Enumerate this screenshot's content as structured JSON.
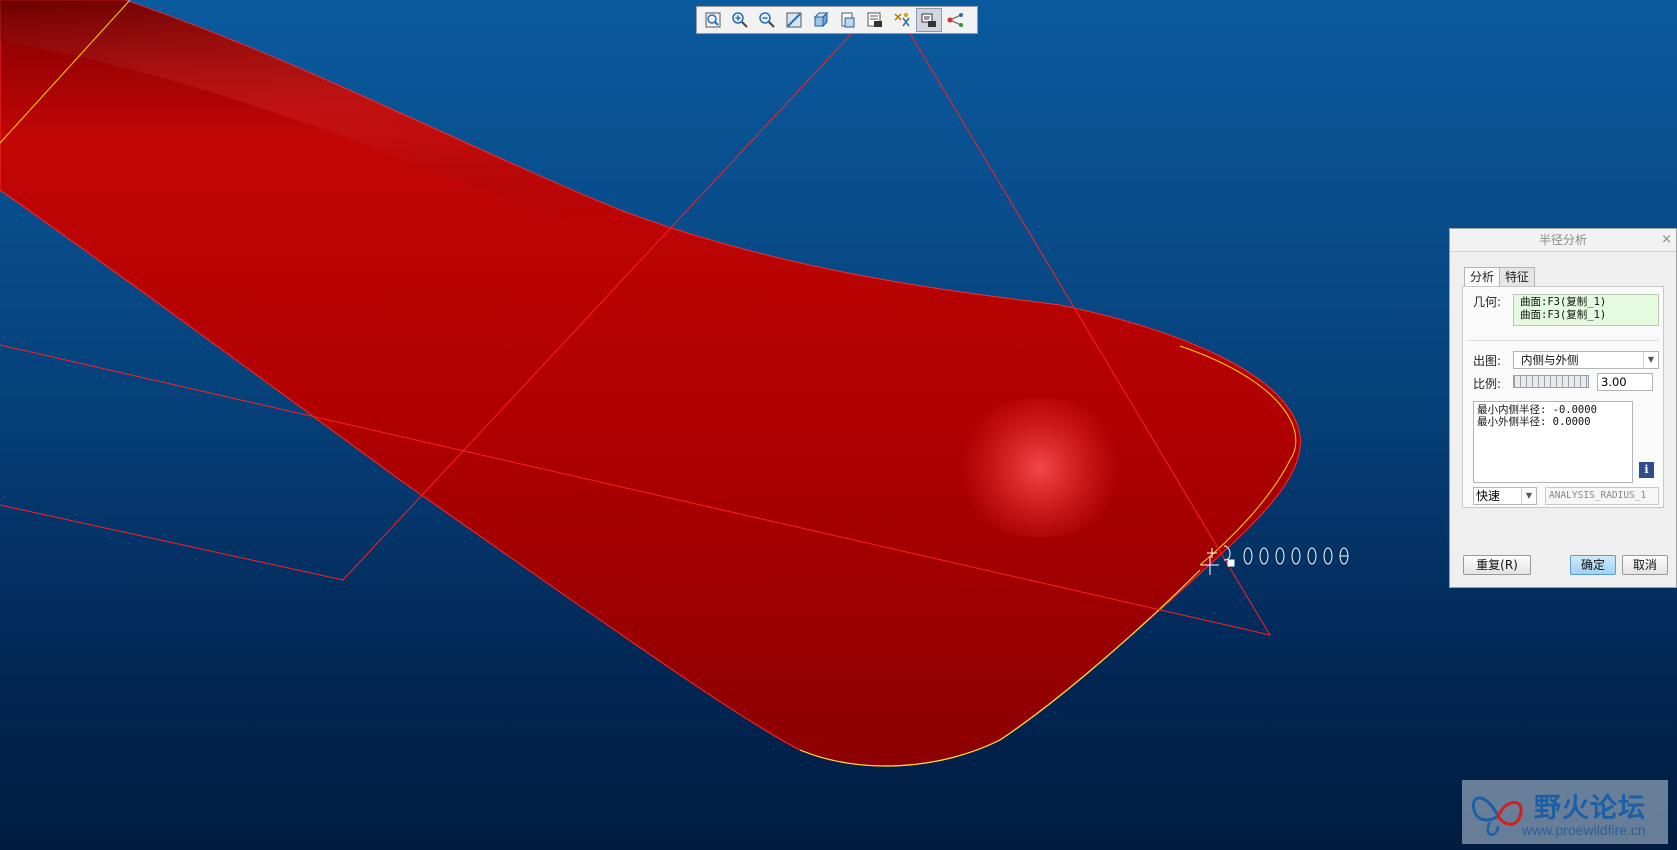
{
  "toolbar": {
    "buttons": [
      {
        "icon": "refit-icon"
      },
      {
        "icon": "zoom-in-icon"
      },
      {
        "icon": "zoom-out-icon"
      },
      {
        "icon": "repaint-icon"
      },
      {
        "icon": "display-style-icon"
      },
      {
        "icon": "saved-views-icon"
      },
      {
        "icon": "layers-icon"
      },
      {
        "icon": "datum-display-icon"
      },
      {
        "icon": "annotation-display-icon",
        "active": true
      },
      {
        "icon": "spin-center-icon"
      }
    ]
  },
  "dialog": {
    "title": "半径分析",
    "close": "×",
    "tabs": [
      "分析",
      "特征"
    ],
    "geometry_label": "几何:",
    "geometry_items": [
      "曲面:F3(复制_1)",
      "曲面:F3(复制_1)"
    ],
    "plot_label": "出图:",
    "plot_value": "内侧与外侧",
    "scale_label": "比例:",
    "scale_value": "3.00",
    "results": [
      "最小内侧半径: -0.0000",
      "最小外侧半径: 0.0000"
    ],
    "info": "i",
    "mode_value": "快速",
    "feature_name": "ANALYSIS_RADIUS_1",
    "repeat_button": "重复(R)",
    "ok_button": "确定",
    "cancel_button": "取消"
  },
  "watermark": {
    "title": "野火论坛",
    "url": "www.proewildfire.cn"
  },
  "colors": {
    "background_top": "#0a5a9e",
    "background_bottom": "#011c40",
    "surface": "#c00000",
    "datum_plane": "#ff2020",
    "edge_highlight": "#ffd800"
  }
}
